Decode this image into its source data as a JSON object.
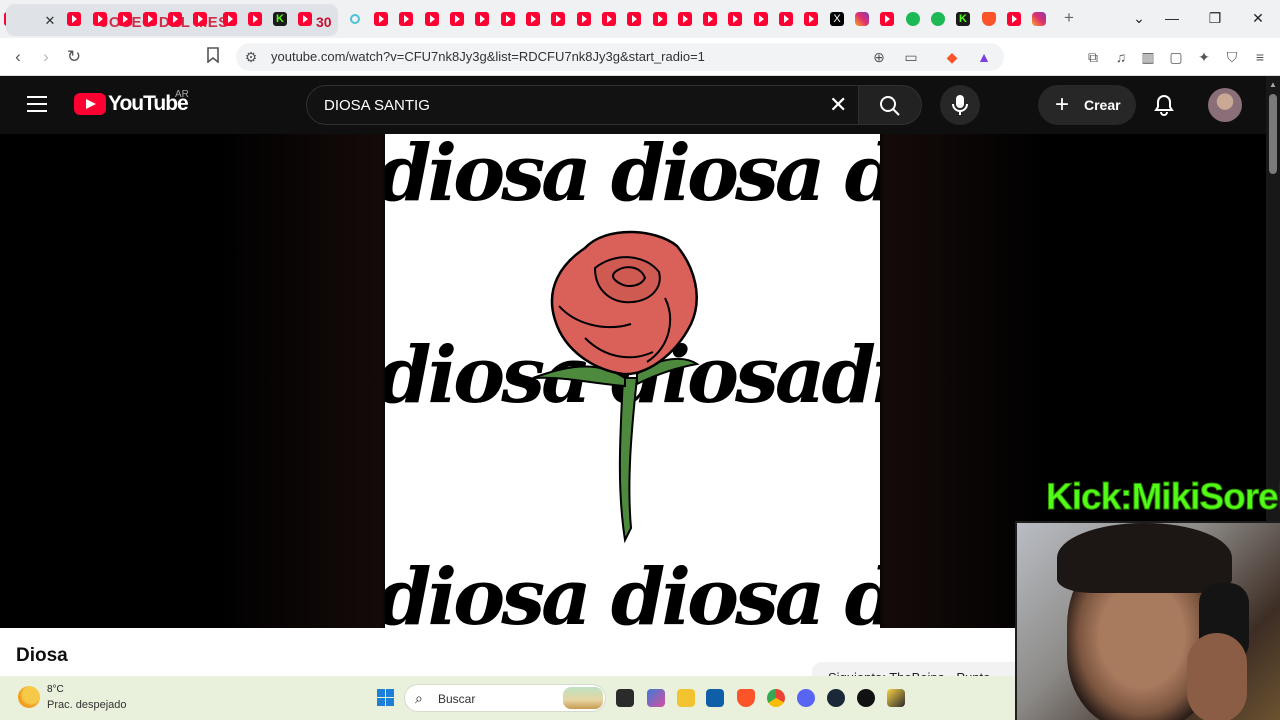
{
  "browser": {
    "active_tab_title": "JOSEO DEL MES",
    "active_tab_number": "30",
    "url": "youtube.com/watch?v=CFU7nk8Jy3g&list=RDCFU7nk8Jy3g&start_radio=1",
    "new_tab_symbol": "+",
    "close_tab_symbol": "✕"
  },
  "youtube": {
    "logo_text": "YouTube",
    "country_code": "AR",
    "search_query": "DIOSA SANTIG",
    "create_label": "Crear",
    "video_title": "Diosa",
    "next_up_text": "Siguiente: TheBoina - Punto",
    "thumbnail_word": "diosa"
  },
  "overlay": {
    "kick_text": "Kick:MikiSorel"
  },
  "taskbar": {
    "temperature": "8°C",
    "weather": "Prac. despejado",
    "search_placeholder": "Buscar"
  },
  "colors": {
    "youtube_red": "#ff0033",
    "kick_green": "#53fc18",
    "rose_red": "#d9615a",
    "stem_green": "#4e8a3e"
  }
}
